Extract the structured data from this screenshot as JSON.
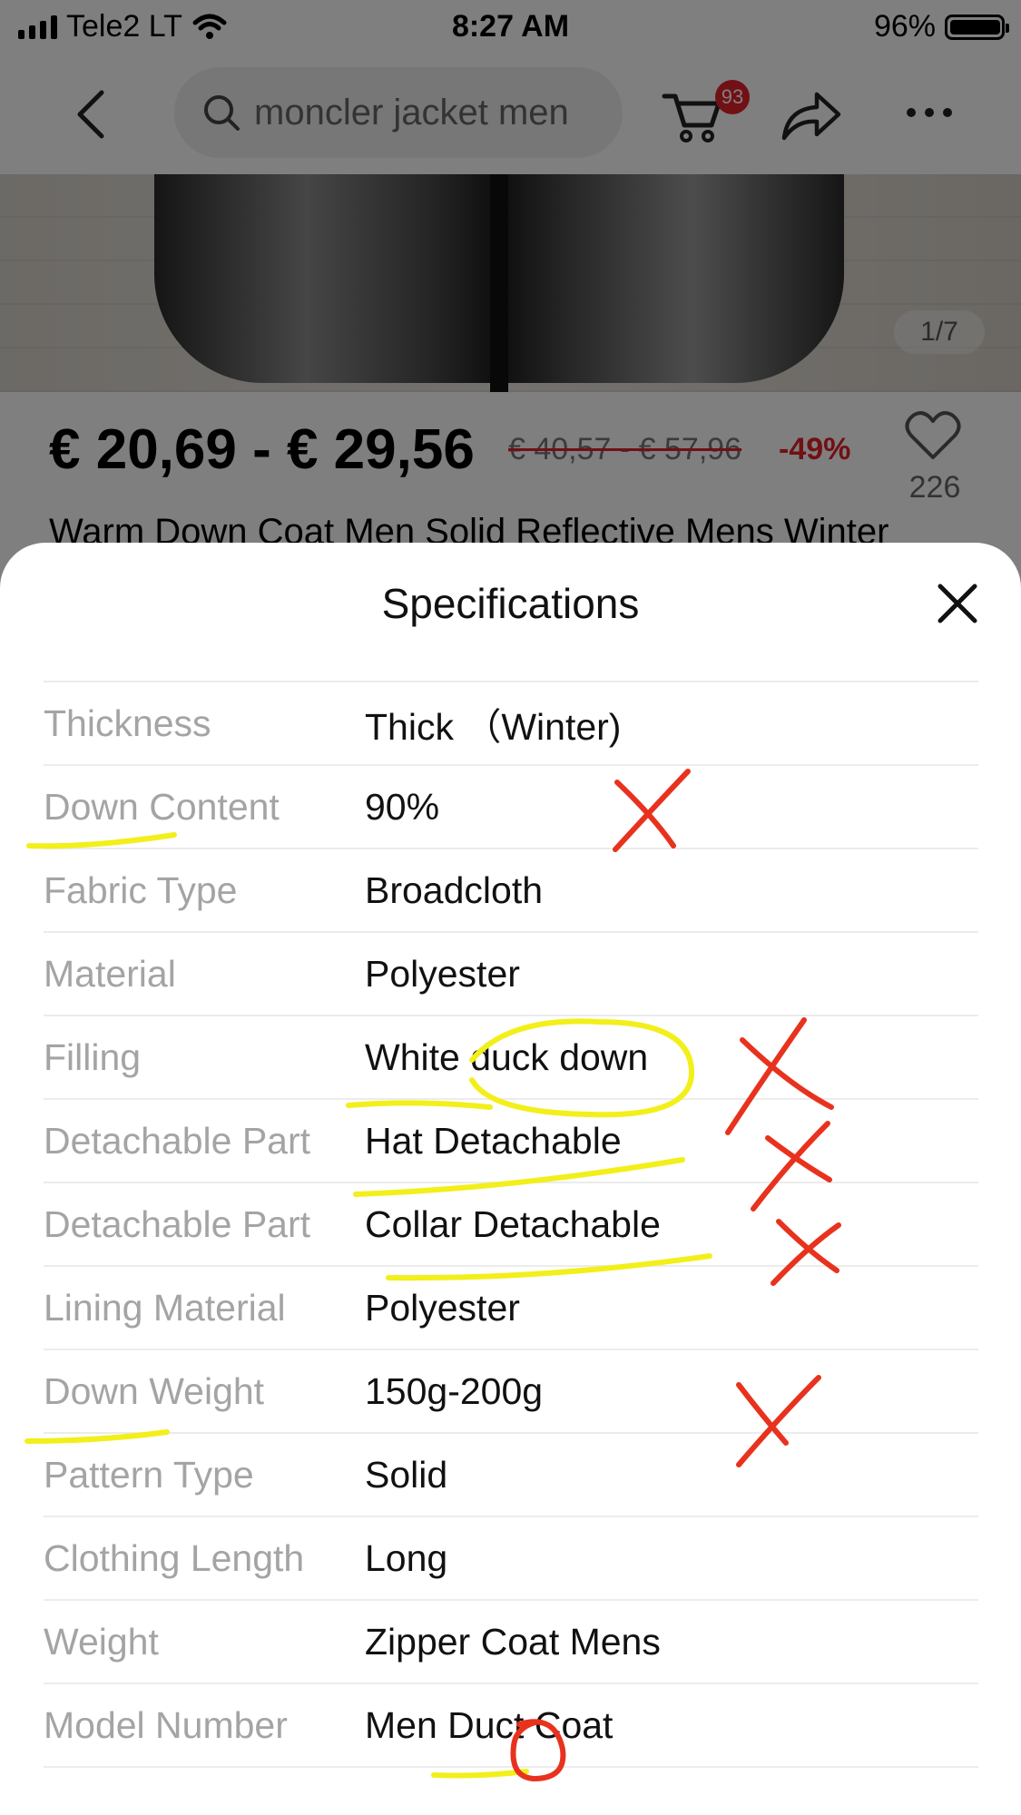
{
  "status_bar": {
    "carrier": "Tele2 LT",
    "time": "8:27 AM",
    "battery": "96%"
  },
  "nav": {
    "search_text": "moncler jacket men",
    "cart_badge": "93"
  },
  "gallery": {
    "counter": "1/7"
  },
  "product": {
    "price": "€ 20,69 - € 29,56",
    "old_price": "€ 40,57 - € 57,96",
    "discount": "-49%",
    "wishlist_count": "226",
    "title": "Warm Down Coat Men Solid Reflective Mens Winter"
  },
  "sheet": {
    "title": "Specifications",
    "rows": [
      {
        "label": "Thickness",
        "value": "Thick （Winter)"
      },
      {
        "label": "Down Content",
        "value": "90%"
      },
      {
        "label": "Fabric Type",
        "value": "Broadcloth"
      },
      {
        "label": "Material",
        "value": "Polyester"
      },
      {
        "label": "Filling",
        "value": "White duck down"
      },
      {
        "label": "Detachable Part",
        "value": "Hat Detachable"
      },
      {
        "label": "Detachable Part",
        "value": "Collar Detachable"
      },
      {
        "label": "Lining Material",
        "value": "Polyester"
      },
      {
        "label": "Down Weight",
        "value": "150g-200g"
      },
      {
        "label": "Pattern Type",
        "value": "Solid"
      },
      {
        "label": "Clothing Length",
        "value": "Long"
      },
      {
        "label": "Weight",
        "value": "Zipper Coat Mens"
      },
      {
        "label": "Model Number",
        "value": "Men Duct Coat"
      }
    ]
  },
  "colors": {
    "accent_red": "#e2202b",
    "highlighter_yellow": "#f2ef1a",
    "annotation_red": "#e8321e"
  }
}
